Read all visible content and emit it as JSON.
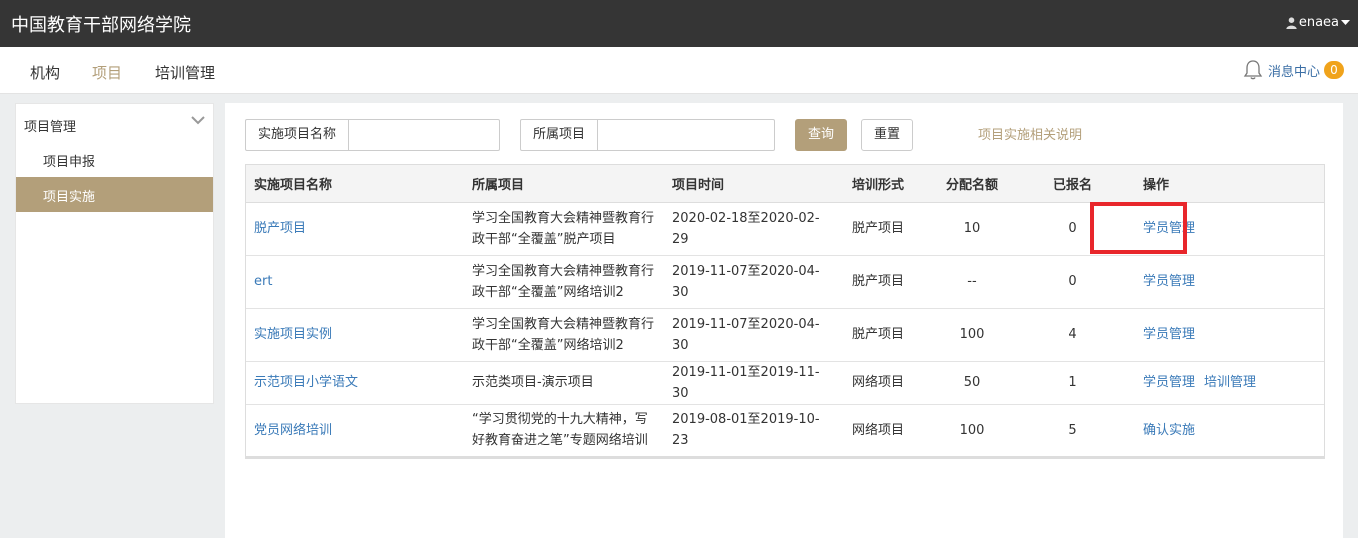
{
  "header": {
    "title": "中国教育干部网络学院",
    "user": "enaea"
  },
  "nav": {
    "items": [
      "机构",
      "项目",
      "培训管理"
    ],
    "active": "项目",
    "message_label": "消息中心",
    "message_count": "0"
  },
  "sidebar": {
    "group_label": "项目管理",
    "items": [
      {
        "label": "项目申报"
      },
      {
        "label": "项目实施"
      }
    ],
    "active": "项目实施"
  },
  "search": {
    "field1_label": "实施项目名称",
    "field1_value": "",
    "field2_label": "所属项目",
    "field2_value": "",
    "query_button": "查询",
    "reset_button": "重置",
    "help_link": "项目实施相关说明"
  },
  "table": {
    "headers": [
      "实施项目名称",
      "所属项目",
      "项目时间",
      "培训形式",
      "分配名额",
      "已报名",
      "操作"
    ],
    "rows": [
      {
        "name": "脱产项目",
        "project": "学习全国教育大会精神暨教育行政干部“全覆盖”脱产项目",
        "time": "2020-02-18至2020-02-29",
        "form": "脱产项目",
        "quota": "10",
        "enrolled": "0",
        "ops": [
          "学员管理"
        ]
      },
      {
        "name": "ert",
        "project": "学习全国教育大会精神暨教育行政干部“全覆盖”网络培训2",
        "time": "2019-11-07至2020-04-30",
        "form": "脱产项目",
        "quota": "--",
        "enrolled": "0",
        "ops": [
          "学员管理"
        ]
      },
      {
        "name": "实施项目实例",
        "project": "学习全国教育大会精神暨教育行政干部“全覆盖”网络培训2",
        "time": "2019-11-07至2020-04-30",
        "form": "脱产项目",
        "quota": "100",
        "enrolled": "4",
        "ops": [
          "学员管理"
        ]
      },
      {
        "name": "示范项目小学语文",
        "project": "示范类项目-演示项目",
        "time": "2019-11-01至2019-11-30",
        "form": "网络项目",
        "quota": "50",
        "enrolled": "1",
        "ops": [
          "学员管理",
          "培训管理"
        ]
      },
      {
        "name": "党员网络培训",
        "project": "“学习贯彻党的十九大精神，写好教育奋进之笔”专题网络培训",
        "time": "2019-08-01至2019-10-23",
        "form": "网络项目",
        "quota": "100",
        "enrolled": "5",
        "ops": [
          "确认实施"
        ]
      }
    ]
  },
  "colors": {
    "accent": "#b39f7a",
    "topbar": "#353535",
    "link": "#3a7ab8",
    "highlight": "#e8262b",
    "badge": "#f0a31b"
  }
}
